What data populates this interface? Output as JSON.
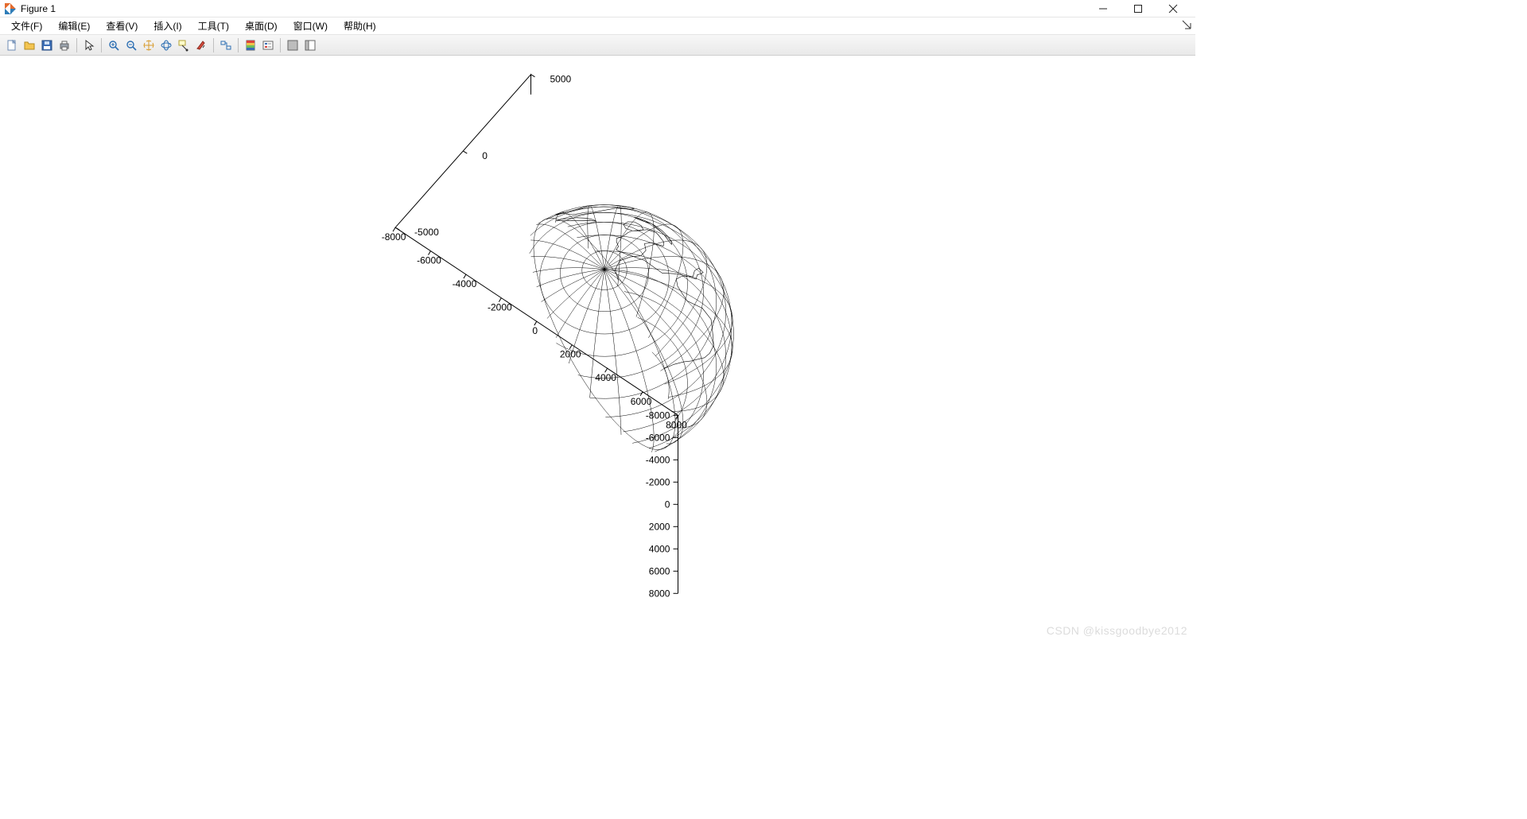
{
  "window": {
    "title": "Figure 1"
  },
  "menu": {
    "items": [
      "文件(F)",
      "编辑(E)",
      "查看(V)",
      "插入(I)",
      "工具(T)",
      "桌面(D)",
      "窗口(W)",
      "帮助(H)"
    ]
  },
  "toolbar": {
    "icons": [
      "new-file-icon",
      "open-file-icon",
      "save-icon",
      "print-icon",
      "|",
      "pointer-icon",
      "|",
      "zoom-in-icon",
      "zoom-out-icon",
      "pan-icon",
      "rotate3d-icon",
      "datatip-icon",
      "brush-icon",
      "|",
      "link-icon",
      "|",
      "colorbar-icon",
      "legend-icon",
      "|",
      "hide-plottools-icon",
      "show-plottools-icon"
    ]
  },
  "chart_data": {
    "type": "3d-globe-wireframe",
    "description": "3-D wireframe sphere (Earth radius scale, ~6371 km) with continental coastlines (Asia/Australia facing viewer) rendered in a MATLAB axes.",
    "view": {
      "azimuth": -37.5,
      "elevation": 30
    },
    "sphere_radius": 6371,
    "z_axis": {
      "ticks": [
        -8000,
        -6000,
        -4000,
        -2000,
        0,
        2000,
        4000,
        6000,
        8000
      ],
      "range": [
        -8000,
        8000
      ]
    },
    "x_axis": {
      "ticks": [
        8000,
        6000,
        4000,
        2000,
        0,
        -2000,
        -4000,
        -6000,
        -8000
      ],
      "range": [
        -8000,
        8000
      ]
    },
    "y_axis": {
      "ticks": [
        -5000,
        0,
        5000
      ],
      "range": [
        -5000,
        5000
      ]
    },
    "grid": {
      "meridians": 24,
      "parallels": 18
    }
  },
  "watermark": "CSDN @kissgoodbye2012"
}
